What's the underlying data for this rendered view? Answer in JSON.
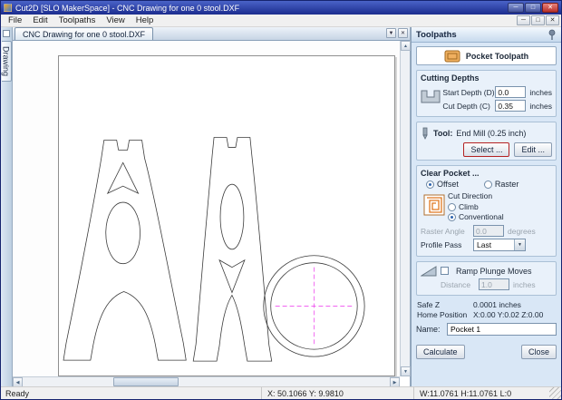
{
  "window": {
    "title": "Cut2D [SLO MakerSpace] - CNC Drawing for one 0 stool.DXF"
  },
  "glyphs": {
    "minimize": "─",
    "maximize": "□",
    "close": "✕",
    "up": "▲",
    "down": "▼",
    "left": "◀",
    "right": "▶",
    "dropdown": "▼"
  },
  "menu": {
    "items": [
      "File",
      "Edit",
      "Toolpaths",
      "View",
      "Help"
    ]
  },
  "left_tab": {
    "label": "Drawing"
  },
  "document_tab": {
    "label": "CNC Drawing for one 0 stool.DXF"
  },
  "toolpaths_panel": {
    "title": "Toolpaths",
    "toolpath_header": "Pocket Toolpath",
    "cutting_depths": {
      "title": "Cutting Depths",
      "start_depth_label": "Start Depth (D)",
      "start_depth_value": "0.0",
      "start_depth_unit": "inches",
      "cut_depth_label": "Cut Depth (C)",
      "cut_depth_value": "0.35",
      "cut_depth_unit": "inches"
    },
    "tool": {
      "label": "Tool:",
      "name": "End Mill (0.25 inch)",
      "select_button": "Select ...",
      "edit_button": "Edit ..."
    },
    "clear_pocket": {
      "title": "Clear Pocket ...",
      "offset_label": "Offset",
      "raster_label": "Raster",
      "cut_direction_label": "Cut Direction",
      "climb_label": "Climb",
      "conventional_label": "Conventional",
      "raster_angle_label": "Raster Angle",
      "raster_angle_value": "0.0",
      "raster_angle_unit": "degrees",
      "profile_pass_label": "Profile Pass",
      "profile_pass_value": "Last"
    },
    "ramp": {
      "label": "Ramp Plunge Moves",
      "distance_label": "Distance",
      "distance_value": "1.0",
      "distance_unit": "inches"
    },
    "info": {
      "safe_z_label": "Safe Z",
      "safe_z_value": "0.0001 inches",
      "home_label": "Home Position",
      "home_value": "X:0.00 Y:0.02 Z:0.00"
    },
    "name_label": "Name:",
    "name_value": "Pocket 1",
    "calculate_button": "Calculate",
    "close_button": "Close"
  },
  "status_bar": {
    "ready": "Ready",
    "cursor": "X: 50.1066 Y: 9.9810",
    "dims": "W:11.0761 H:11.0761 L:0"
  }
}
